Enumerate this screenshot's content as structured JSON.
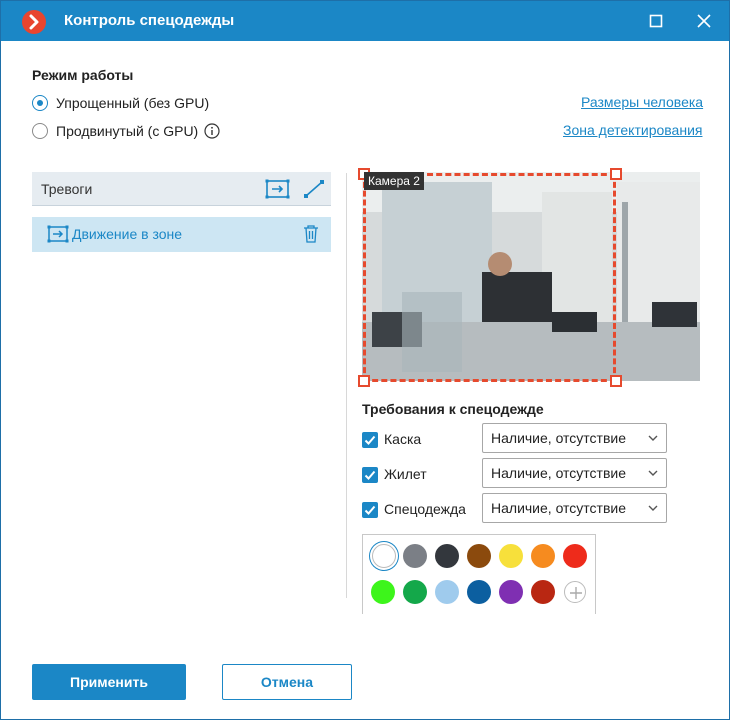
{
  "window": {
    "title": "Контроль спецодежды",
    "accent_color": "#1b87c6",
    "icons": {
      "app": "app-logo-icon",
      "maximize": "maximize-icon",
      "close": "close-icon"
    }
  },
  "mode": {
    "title": "Режим работы",
    "options": [
      {
        "label": "Упрощенный (без GPU)",
        "checked": true
      },
      {
        "label": "Продвинутый (с GPU)",
        "checked": false,
        "icon": "info-icon"
      }
    ],
    "links": {
      "person_size": "Размеры человека",
      "detection_zone": "Зона детектирования"
    }
  },
  "alarms": {
    "header": "Тревоги",
    "header_icons": [
      "add-zone-icon",
      "add-line-icon"
    ],
    "items": [
      {
        "label": "Движение в зоне",
        "icon": "zone-icon",
        "action_icon": "trash-icon"
      }
    ]
  },
  "camera": {
    "label": "Камера 2",
    "zone_color": "#e64a2e"
  },
  "requirements": {
    "title": "Требования к спецодежде",
    "items": [
      {
        "label": "Каска",
        "checked": true,
        "value": "Наличие, отсутствие"
      },
      {
        "label": "Жилет",
        "checked": true,
        "value": "Наличие, отсутствие"
      },
      {
        "label": "Спецодежда",
        "checked": true,
        "value": "Наличие, отсутствие"
      }
    ],
    "colors": [
      {
        "hex": "#ffffff",
        "selected": true
      },
      {
        "hex": "#7b7f86"
      },
      {
        "hex": "#33373d"
      },
      {
        "hex": "#8b4a0d"
      },
      {
        "hex": "#f7e03b"
      },
      {
        "hex": "#f68b1f"
      },
      {
        "hex": "#ee2b1b"
      },
      {
        "hex": "#3df51b"
      },
      {
        "hex": "#14a84a"
      },
      {
        "hex": "#9fcbed"
      },
      {
        "hex": "#0c5fa0"
      },
      {
        "hex": "#7f2fb2"
      },
      {
        "hex": "#b92712"
      }
    ],
    "add_color_icon": "plus-icon"
  },
  "buttons": {
    "apply": "Применить",
    "cancel": "Отмена"
  }
}
